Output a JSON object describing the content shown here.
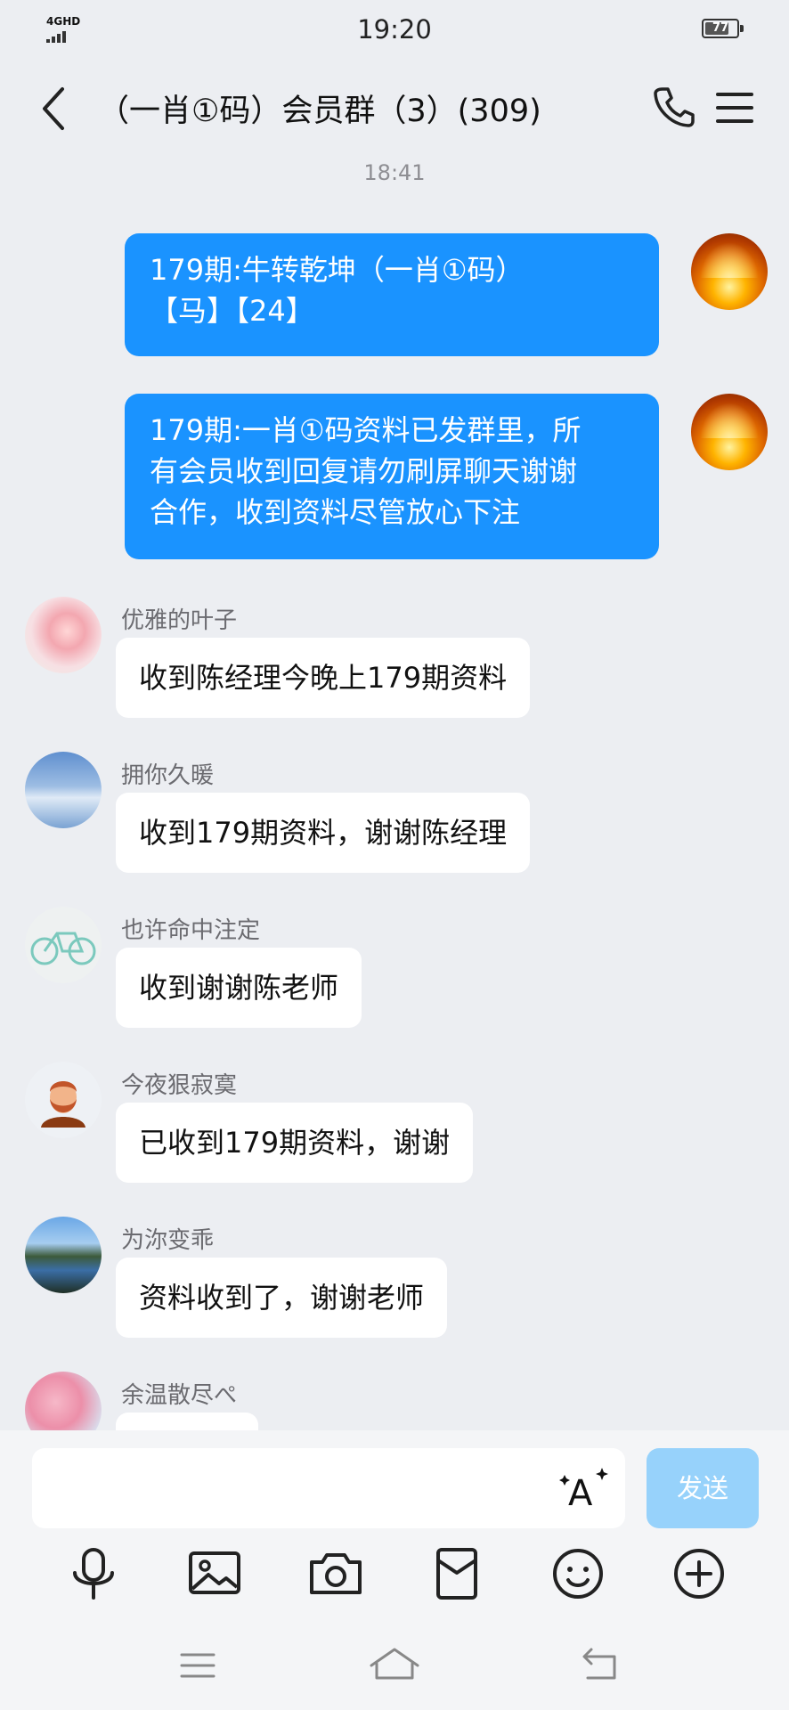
{
  "status_bar": {
    "network": "4GHD",
    "time": "19:20",
    "battery": "77",
    "battery_level": 0.77
  },
  "header": {
    "title": "（一肖①码）会员群（3）(309)",
    "back_icon": "chevron-left-icon",
    "call_icon": "phone-icon",
    "menu_icon": "hamburger-menu-icon"
  },
  "chat": {
    "timestamp": "18:41",
    "my_messages": [
      {
        "lines": [
          "179期:牛转乾坤（一肖①码）",
          "【马】【24】"
        ]
      },
      {
        "lines": [
          "179期:一肖①码资料已发群里，所",
          "有会员收到回复请勿刷屏聊天谢谢",
          "合作，收到资料尽管放心下注"
        ]
      }
    ],
    "messages": [
      {
        "sender": "优雅的叶子",
        "text": "收到陈经理今晚上179期资料"
      },
      {
        "sender": "拥你久暖",
        "text": "收到179期资料，谢谢陈经理"
      },
      {
        "sender": "也许命中注定",
        "text": "收到谢谢陈老师"
      },
      {
        "sender": "今夜狠寂寞",
        "text": "已收到179期资料，谢谢"
      },
      {
        "sender": "为沵变乖",
        "text": "资料收到了，谢谢老师"
      },
      {
        "sender": "余温散尽ぺ",
        "text": ""
      }
    ]
  },
  "composer": {
    "input_value": "",
    "font_icon": "font-style-icon",
    "send_label": "发送",
    "send_color": "#97d2fb",
    "tools": [
      "microphone-icon",
      "image-icon",
      "camera-icon",
      "red-packet-icon",
      "emoji-icon",
      "plus-icon"
    ]
  },
  "navigation": {
    "icons": [
      "menu-nav-icon",
      "home-nav-icon",
      "back-nav-icon"
    ]
  },
  "colors": {
    "outgoing_bubble": "#1a93ff",
    "incoming_bubble": "#ffffff",
    "background": "#eceef2"
  }
}
